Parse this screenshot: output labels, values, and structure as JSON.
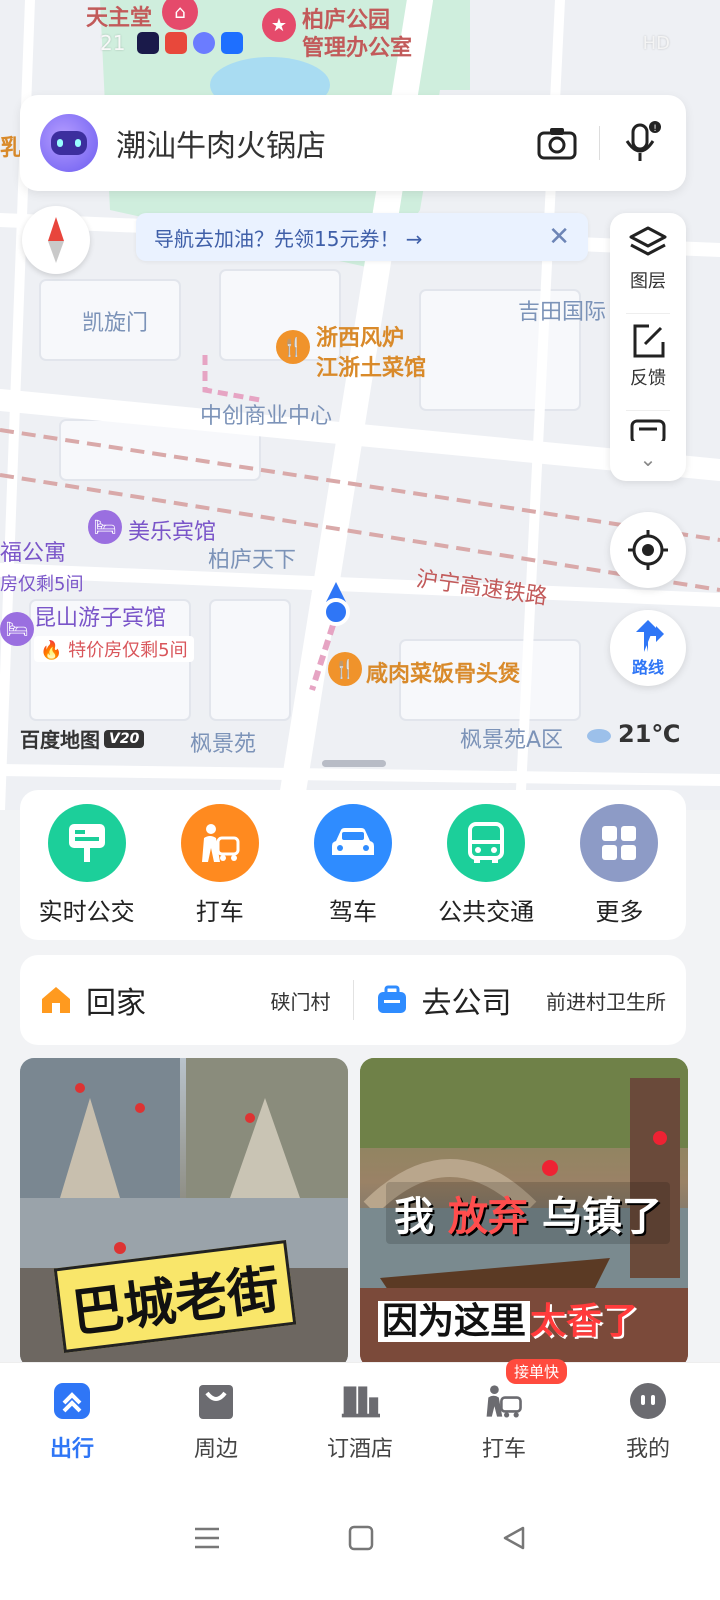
{
  "status_bar": {
    "time": "21",
    "right_text": "HD"
  },
  "map": {
    "labels": {
      "tianzhutang": "天主堂",
      "bailu_park_line1": "柏庐公园",
      "bailu_park_line2": "管理办公室",
      "kaixuanmen": "凯旋门",
      "jitian": "吉田国际",
      "zhexi_line1": "浙西风炉",
      "zhexi_line2": "江浙土菜馆",
      "zhongchuang": "中创商业中心",
      "meile": "美乐宾馆",
      "bailu_tianxia": "柏庐天下",
      "fu_apartment": "福公寓",
      "fu_apartment_sub": "房仅剩5间",
      "huning": "沪宁高速铁路",
      "kunshan_hotel": "昆山游子宾馆",
      "kunshan_sub": "特价房仅剩5间",
      "xianrou": "咸肉菜饭骨头煲",
      "fengjingyuan": "枫景苑",
      "fengjingyuan_a": "枫景苑A区",
      "left_edge": "乳"
    },
    "logo_text": "百度地图",
    "logo_version": "V20",
    "weather_temp": "21℃"
  },
  "search": {
    "query": "潮汕牛肉火锅店"
  },
  "promo": {
    "text": "导航去加油？先领15元券！ →"
  },
  "right_panel": {
    "layers_label": "图层",
    "feedback_label": "反馈"
  },
  "route_button": {
    "label": "路线"
  },
  "quick_actions": [
    {
      "label": "实时公交",
      "color": "#1ccf9a"
    },
    {
      "label": "打车",
      "color": "#ff8a1f"
    },
    {
      "label": "驾车",
      "color": "#2f8cff"
    },
    {
      "label": "公共交通",
      "color": "#1ccf9a"
    },
    {
      "label": "更多",
      "color": "#8d9bc6"
    }
  ],
  "shortcuts": {
    "home": {
      "title": "回家",
      "sub": "硖门村"
    },
    "company": {
      "title": "去公司",
      "sub": "前进村卫生所"
    }
  },
  "feed": {
    "left_title": "巴城老街",
    "right_line1_a": "我",
    "right_line1_b": "放弃",
    "right_line1_c": "乌镇了",
    "right_line2_a": "因为这里",
    "right_line2_b": "太香了"
  },
  "tabs": [
    {
      "label": "出行",
      "active": true
    },
    {
      "label": "周边"
    },
    {
      "label": "订酒店"
    },
    {
      "label": "打车",
      "badge": "接单快"
    },
    {
      "label": "我的"
    }
  ],
  "colors": {
    "accent": "#2f76f6",
    "map_bg": "#eef0f4"
  }
}
